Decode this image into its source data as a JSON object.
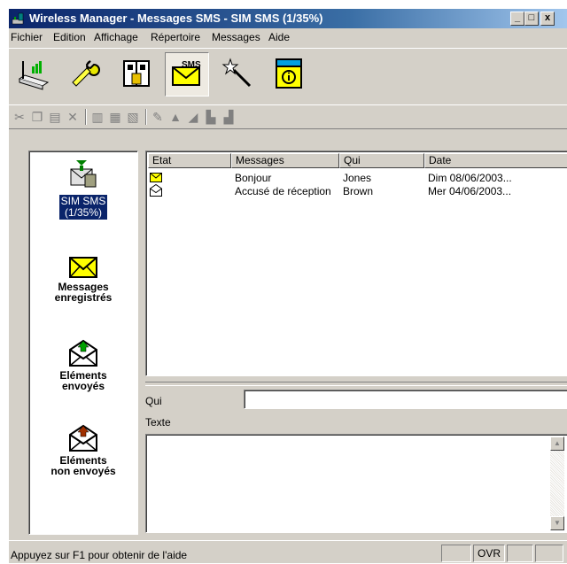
{
  "window": {
    "title": "Wireless Manager - Messages SMS - SIM SMS (1/35%)",
    "buttons": {
      "minimize": "_",
      "maximize": "□",
      "close": "x"
    }
  },
  "menu": {
    "items": [
      {
        "label": "Fichier"
      },
      {
        "label": "Edition"
      },
      {
        "label": "Affichage"
      },
      {
        "label": "Répertoire"
      },
      {
        "label": "Messages"
      },
      {
        "label": "Aide"
      }
    ]
  },
  "toolbar": {
    "sms_label": "SMS"
  },
  "sidebar": {
    "items": [
      {
        "label": "SIM SMS\n(1/35%)",
        "line1": "SIM SMS",
        "line2": "(1/35%)"
      },
      {
        "line1": "Messages",
        "line2": "enregistrés"
      },
      {
        "line1": "Eléments",
        "line2": "envoyés"
      },
      {
        "line1": "Eléments",
        "line2": "non envoyés"
      }
    ]
  },
  "message_list": {
    "columns": [
      "Etat",
      "Messages",
      "Qui",
      "Date"
    ],
    "rows": [
      {
        "state_icon": "envelope-new-icon",
        "message": "Bonjour",
        "who": "Jones",
        "date": "Dim 08/06/2003..."
      },
      {
        "state_icon": "envelope-read-icon",
        "message": "Accusé de réception",
        "who": "Brown",
        "date": "Mer 04/06/2003..."
      }
    ]
  },
  "detail": {
    "qui_label": "Qui",
    "texte_label": "Texte",
    "qui_value": "",
    "texte_value": ""
  },
  "statusbar": {
    "help_text": "Appuyez sur F1 pour obtenir de l'aide",
    "ovr": "OVR"
  },
  "colors": {
    "title_start": "#0a246a",
    "title_end": "#a6caf0",
    "selection": "#0a246a",
    "envelope": "#ffff00"
  }
}
